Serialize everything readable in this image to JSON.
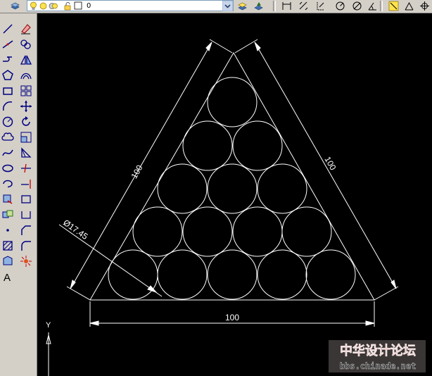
{
  "layer_toolbar": {
    "current_layer": "0"
  },
  "drawing": {
    "dimensions": {
      "left_side": "100",
      "right_side": "100",
      "bottom": "100",
      "circle_diameter": "Ø17.45"
    },
    "ucs_y_label": "Y"
  },
  "watermark": {
    "brand_cn": "中华设计论坛",
    "url": "bbs.chinade.net"
  },
  "colors": {
    "canvas_bg": "#000000",
    "line": "#ffffff",
    "watermark_cn": "#b71c1c",
    "watermark_url": "#2e2e2e"
  }
}
